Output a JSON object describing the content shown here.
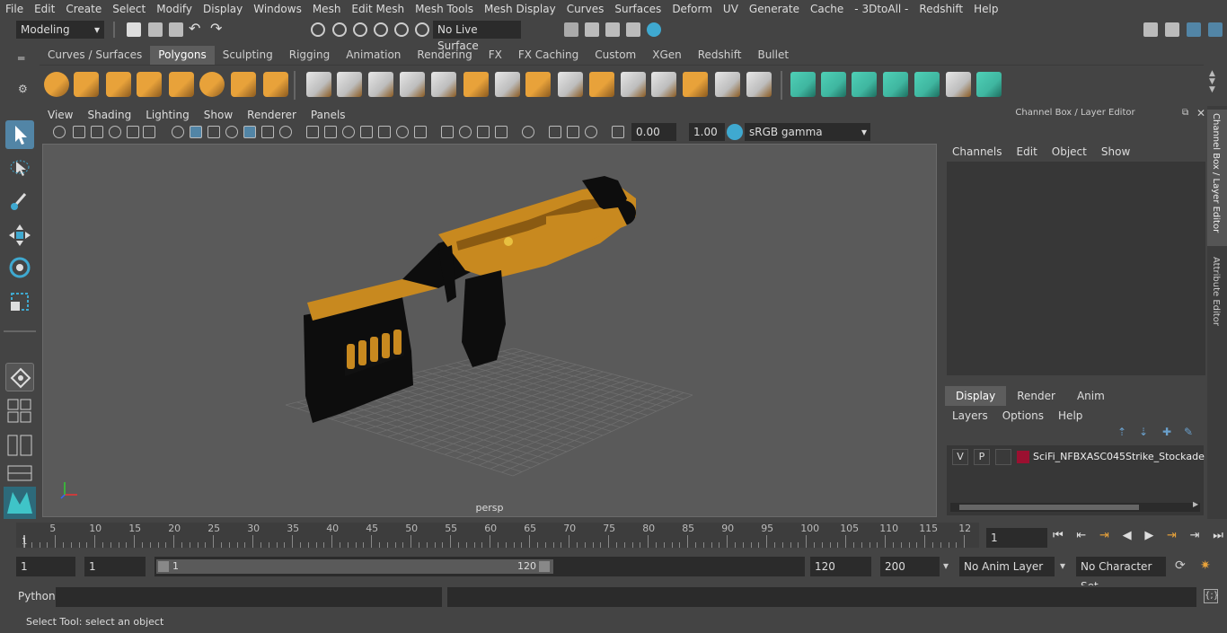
{
  "menu": [
    "File",
    "Edit",
    "Create",
    "Select",
    "Modify",
    "Display",
    "Windows",
    "Mesh",
    "Edit Mesh",
    "Mesh Tools",
    "Mesh Display",
    "Curves",
    "Surfaces",
    "Deform",
    "UV",
    "Generate",
    "Cache",
    "- 3DtoAll -",
    "Redshift",
    "Help"
  ],
  "status": {
    "mode": "Modeling",
    "live_surface": "No Live Surface"
  },
  "shelf_tabs": [
    "Curves / Surfaces",
    "Polygons",
    "Sculpting",
    "Rigging",
    "Animation",
    "Rendering",
    "FX",
    "FX Caching",
    "Custom",
    "XGen",
    "Redshift",
    "Bullet"
  ],
  "active_shelf_tab": "Polygons",
  "viewport": {
    "menu": [
      "View",
      "Shading",
      "Lighting",
      "Show",
      "Renderer",
      "Panels"
    ],
    "exposure": "0.00",
    "gamma": "1.00",
    "color_space": "sRGB gamma",
    "camera_label": "persp"
  },
  "channel_box": {
    "title": "Channel Box / Layer Editor",
    "menu": [
      "Channels",
      "Edit",
      "Object",
      "Show"
    ],
    "tabs": [
      "Display",
      "Render",
      "Anim"
    ],
    "active_tab": "Display",
    "layer_menu": [
      "Layers",
      "Options",
      "Help"
    ],
    "layer": {
      "v": "V",
      "p": "P",
      "name": "SciFi_NFBXASC045Strike_Stockade",
      "color": "#9b1030"
    }
  },
  "side_tabs": [
    "Channel Box / Layer Editor",
    "Attribute Editor"
  ],
  "timeline": {
    "ticks": [
      "5",
      "10",
      "15",
      "20",
      "25",
      "30",
      "35",
      "40",
      "45",
      "50",
      "55",
      "60",
      "65",
      "70",
      "75",
      "80",
      "85",
      "90",
      "95",
      "100",
      "105",
      "110",
      "115",
      "12"
    ],
    "start_marker": "1",
    "current_frame": "1"
  },
  "range": {
    "start": "1",
    "playback_start": "1",
    "slider_start": "1",
    "slider_end": "120",
    "playback_end": "120",
    "end": "200",
    "anim_layer": "No Anim Layer",
    "character_set": "No Character Set"
  },
  "command": {
    "lang": "Python"
  },
  "help_text": "Select Tool: select an object",
  "colors": {
    "accent_orange": "#e8a23a",
    "shelf_teal": "#3fb6a0",
    "selected_blue": "#5285a6"
  }
}
